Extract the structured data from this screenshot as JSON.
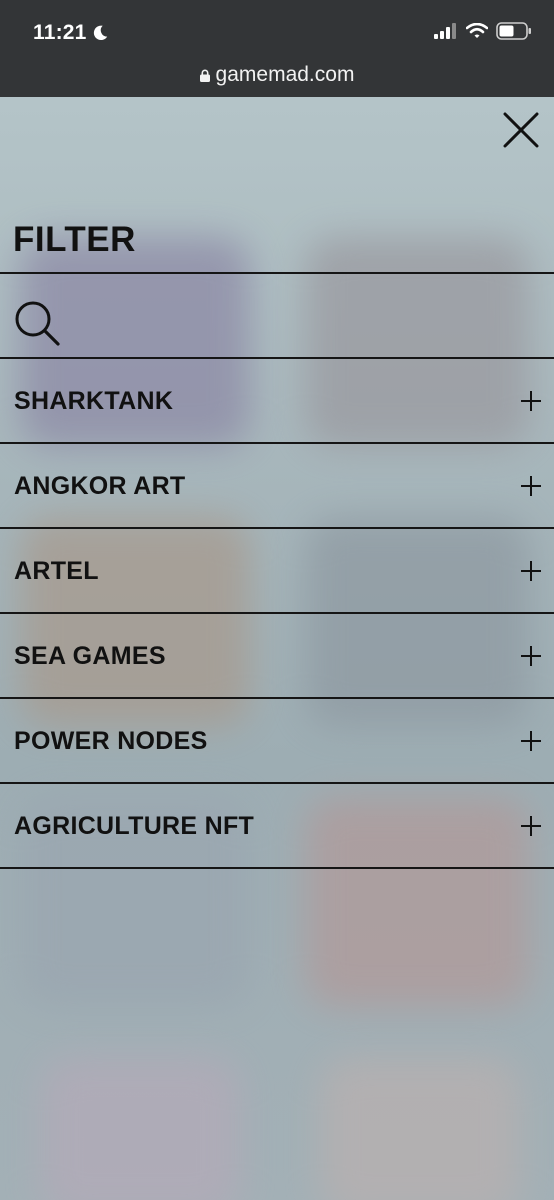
{
  "status_bar": {
    "time": "11:21"
  },
  "browser": {
    "url": "gamemad.com"
  },
  "filter": {
    "title": "FILTER",
    "search_placeholder": "",
    "categories": [
      {
        "label": "SHARKTANK"
      },
      {
        "label": "ANGKOR ART"
      },
      {
        "label": "ARTEL"
      },
      {
        "label": "SEA GAMES"
      },
      {
        "label": "POWER NODES"
      },
      {
        "label": "AGRICULTURE NFT"
      }
    ]
  },
  "icons": {
    "close": "close-icon",
    "search": "search-icon",
    "expand": "plus-icon",
    "moon": "moon-icon",
    "lock": "lock-icon",
    "signal": "cellular-signal-icon",
    "wifi": "wifi-icon",
    "battery": "battery-icon"
  },
  "colors": {
    "topbar": "#333537",
    "text": "#111111",
    "rule": "#151515"
  }
}
